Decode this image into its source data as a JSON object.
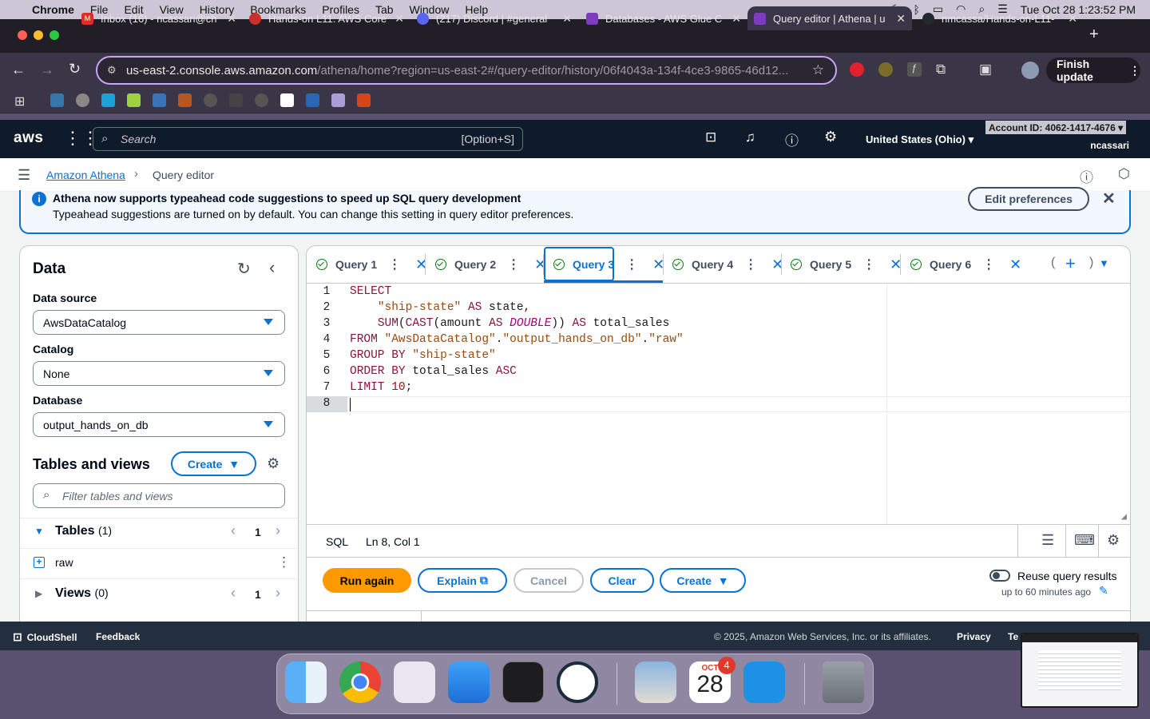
{
  "menubar": {
    "app": "Chrome",
    "items": [
      "File",
      "Edit",
      "View",
      "History",
      "Bookmarks",
      "Profiles",
      "Tab",
      "Window",
      "Help"
    ],
    "datetime": "Tue Oct 28  1:23:52 PM"
  },
  "browser": {
    "tabs": [
      {
        "title": "Inbox (16) - ncassari@ch",
        "color": "#d93025"
      },
      {
        "title": "Hands-on L11: AWS Core",
        "color": "#c9302c"
      },
      {
        "title": "(217) Discord | #general",
        "color": "#5865f2"
      },
      {
        "title": "Databases - AWS Glue C",
        "color": "#7d3cbd"
      },
      {
        "title": "Query editor | Athena | u",
        "color": "#7d3cbd"
      },
      {
        "title": "nmcassa/Hands-on-L11-",
        "color": "#24292f"
      }
    ],
    "url_host": "us-east-2.console.aws.amazon.com",
    "url_path": "/athena/home?region=us-east-2#/query-editor/history/06f4043a-134f-4ce3-9865-46d12...",
    "finish_update": "Finish update"
  },
  "aws": {
    "logo": "aws",
    "search_placeholder": "Search",
    "search_shortcut": "[Option+S]",
    "region": "United States (Ohio)",
    "account_id": "Account ID: 4062-1417-4676",
    "username": "ncassari"
  },
  "breadcrumb": {
    "root": "Amazon Athena",
    "current": "Query editor"
  },
  "flash": {
    "title": "Athena now supports typeahead code suggestions to speed up SQL query development",
    "body": "Typeahead suggestions are turned on by default. You can change this setting in query editor preferences.",
    "button": "Edit preferences"
  },
  "data_panel": {
    "title": "Data",
    "data_source_label": "Data source",
    "data_source_value": "AwsDataCatalog",
    "catalog_label": "Catalog",
    "catalog_value": "None",
    "database_label": "Database",
    "database_value": "output_hands_on_db",
    "tables_views_title": "Tables and views",
    "create_button": "Create",
    "filter_placeholder": "Filter tables and views",
    "tables_label": "Tables",
    "tables_count": "(1)",
    "tables_page": "1",
    "table_item": "raw",
    "views_label": "Views",
    "views_count": "(0)",
    "views_page": "1"
  },
  "editor": {
    "tabs": [
      "Query 1",
      "Query 2",
      "Query 3",
      "Query 4",
      "Query 5",
      "Query 6"
    ],
    "active_tab": "Query 3",
    "line_numbers": [
      "1",
      "2",
      "3",
      "4",
      "5",
      "6",
      "7",
      "8"
    ],
    "status_lang": "SQL",
    "status_pos": "Ln 8, Col 1",
    "run_button": "Run again",
    "explain_button": "Explain",
    "cancel_button": "Cancel",
    "clear_button": "Clear",
    "create_button": "Create",
    "reuse_label": "Reuse query results",
    "reuse_sub": "up to 60 minutes ago"
  },
  "footer": {
    "cloudshell": "CloudShell",
    "feedback": "Feedback",
    "copyright": "© 2025, Amazon Web Services, Inc. or its affiliates.",
    "privacy": "Privacy",
    "terms": "Te"
  },
  "dock": {
    "calendar_month": "OCT",
    "calendar_day": "28",
    "calendar_badge": "4"
  }
}
